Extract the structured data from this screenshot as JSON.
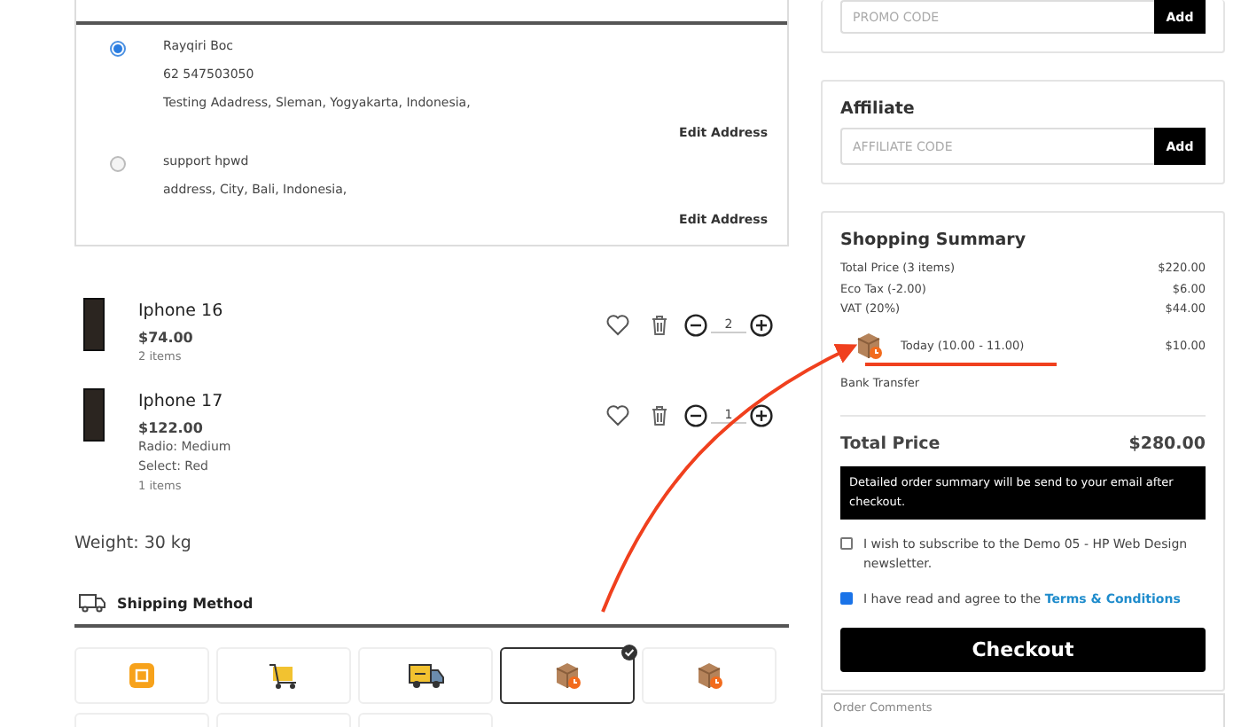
{
  "addresses": [
    {
      "name": "Rayqiri Boc",
      "phone": "62 547503050",
      "address": "Testing Adadress, Sleman, Yogyakarta, Indonesia,",
      "edit": "Edit Address",
      "selected": true
    },
    {
      "name": "support hpwd",
      "address": "address, City, Bali, Indonesia,",
      "edit": "Edit Address",
      "selected": false
    }
  ],
  "cart": [
    {
      "name": "Iphone 16",
      "price": "$74.00",
      "count": "2 items",
      "quantity": "2"
    },
    {
      "name": "Iphone 17",
      "price": "$122.00",
      "options": [
        "Radio: Medium",
        "Select: Red"
      ],
      "count": "1 items",
      "quantity": "1"
    }
  ],
  "weight": "Weight: 30 kg",
  "shipping": {
    "title": "Shipping Method",
    "options": [
      {
        "kind": "tag",
        "selected": false
      },
      {
        "kind": "cart",
        "selected": false
      },
      {
        "kind": "truck",
        "selected": false
      },
      {
        "kind": "parcel",
        "selected": true
      },
      {
        "kind": "parcel",
        "selected": false
      },
      {
        "kind": "blank",
        "selected": false
      },
      {
        "kind": "blank",
        "selected": false
      },
      {
        "kind": "blank",
        "selected": false
      }
    ]
  },
  "promo": {
    "placeholder": "PROMO CODE",
    "button": "Add"
  },
  "affiliate": {
    "title": "Affiliate",
    "placeholder": "AFFILIATE CODE",
    "button": "Add"
  },
  "summary": {
    "title": "Shopping Summary",
    "lines": [
      {
        "label": "Total Price (3 items)",
        "value": "$220.00"
      },
      {
        "label": "Eco Tax (-2.00)",
        "value": "$6.00"
      },
      {
        "label": "VAT (20%)",
        "value": "$44.00"
      }
    ],
    "delivery": {
      "label": "Today (10.00 - 11.00)",
      "value": "$10.00"
    },
    "payment": "Bank Transfer",
    "total_label": "Total Price",
    "total": "$280.00",
    "notice": "Detailed order summary will be send to your email after checkout.",
    "newsletter": {
      "text": "I wish to subscribe to the Demo 05 - HP Web Design newsletter.",
      "checked": false
    },
    "terms": {
      "text": "I have read and agree to the",
      "link": "Terms & Conditions",
      "checked": true
    },
    "checkout": "Checkout"
  },
  "comments": {
    "placeholder": "Order Comments"
  }
}
